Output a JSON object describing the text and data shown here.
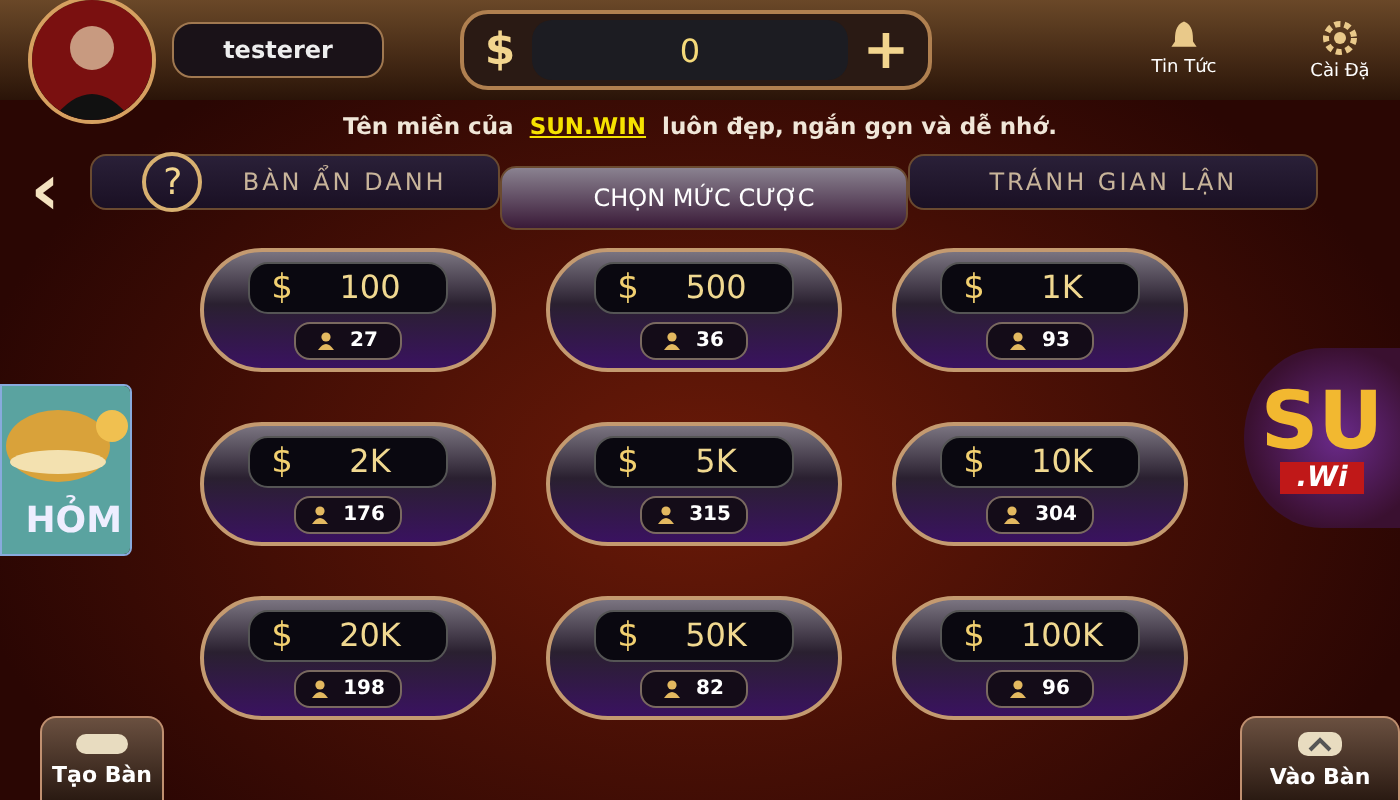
{
  "player": {
    "name": "testerer"
  },
  "balance": {
    "currency": "$",
    "amount": "0",
    "add": "+"
  },
  "top_menu": [
    {
      "label": "Tin Tức",
      "kind": "bell"
    },
    {
      "label": "Cài Đặ",
      "kind": "gear"
    }
  ],
  "notice": {
    "before": "Tên miền của",
    "highlight": "SUN.WIN",
    "after": "luôn đẹp, ngắn gọn và dễ nhớ."
  },
  "back": "‹",
  "tabs": [
    {
      "label": "BÀN ẨN DANH",
      "selected": false,
      "help": "?"
    },
    {
      "label": "CHỌN MỨC CƯỢC",
      "selected": true
    },
    {
      "label": "TRÁNH GIAN LẬN",
      "selected": false
    }
  ],
  "bets": [
    {
      "currency": "$",
      "amount": "100",
      "players": "27"
    },
    {
      "currency": "$",
      "amount": "500",
      "players": "36"
    },
    {
      "currency": "$",
      "amount": "1K",
      "players": "93"
    },
    {
      "currency": "$",
      "amount": "2K",
      "players": "176"
    },
    {
      "currency": "$",
      "amount": "5K",
      "players": "315"
    },
    {
      "currency": "$",
      "amount": "10K",
      "players": "304"
    },
    {
      "currency": "$",
      "amount": "20K",
      "players": "198"
    },
    {
      "currency": "$",
      "amount": "50K",
      "players": "82"
    },
    {
      "currency": "$",
      "amount": "100K",
      "players": "96"
    }
  ],
  "side_banner": {
    "text": "HỎM"
  },
  "logo": {
    "main": "SU",
    "sub": ".Wi"
  },
  "bottom_buttons": [
    {
      "label": "Tạo Bàn",
      "kind": "create"
    },
    {
      "label": "Vào Bàn",
      "kind": "join"
    }
  ]
}
